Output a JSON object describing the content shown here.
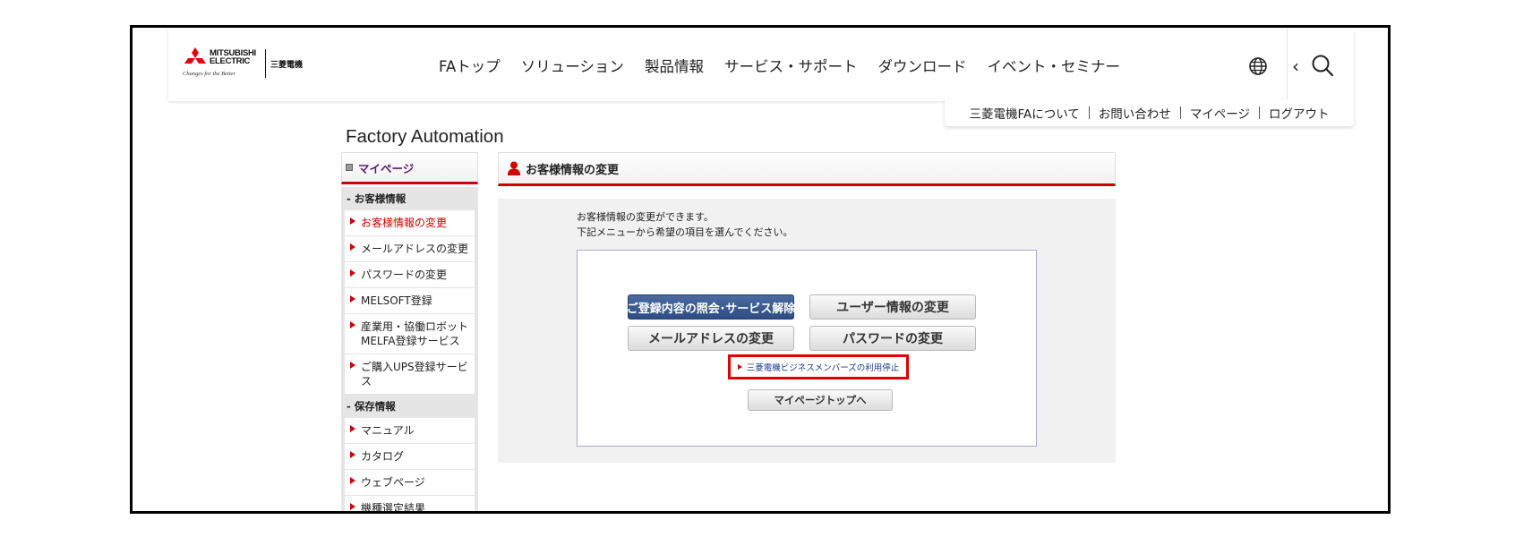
{
  "header": {
    "logo": {
      "brand_line1": "MITSUBISHI",
      "brand_line2": "ELECTRIC",
      "tagline": "Changes for the Better",
      "jp_name": "三菱電機"
    },
    "nav": [
      "FAトップ",
      "ソリューション",
      "製品情報",
      "サービス・サポート",
      "ダウンロード",
      "イベント・セミナー"
    ],
    "icons": {
      "globe": "globe-icon",
      "back": "chevron-left-icon",
      "search": "search-icon"
    }
  },
  "utility_links": [
    "三菱電機FAについて",
    "お問い合わせ",
    "マイページ",
    "ログアウト"
  ],
  "page_title": "Factory Automation",
  "sidebar": {
    "title": "マイページ",
    "sections": [
      {
        "label": "- お客様情報",
        "items": [
          {
            "label": "お客様情報の変更",
            "active": true
          },
          {
            "label": "メールアドレスの変更"
          },
          {
            "label": "パスワードの変更"
          },
          {
            "label": "MELSOFT登録"
          },
          {
            "label": "産業用・協働ロボット MELFA登録サービス",
            "line1": "産業用・協働ロボット",
            "line2": "MELFA登録サービス"
          },
          {
            "label": "ご購入UPS登録サービス"
          }
        ]
      },
      {
        "label": "- 保存情報",
        "items": [
          {
            "label": "マニュアル"
          },
          {
            "label": "カタログ"
          },
          {
            "label": "ウェブページ"
          },
          {
            "label": "機種選定結果"
          }
        ]
      }
    ]
  },
  "main": {
    "heading": "お客様情報の変更",
    "description_line1": "お客様情報の変更ができます。",
    "description_line2": "下記メニューから希望の項目を選んでください。",
    "buttons": {
      "inquiry": "ご登録内容の照会･サービス解除",
      "user_info": "ユーザー情報の変更",
      "email": "メールアドレスの変更",
      "password": "パスワードの変更",
      "mypage_top": "マイページトップへ"
    },
    "stop_link": "三菱電機ビジネスメンバーズの利用停止"
  },
  "colors": {
    "accent_red": "#cc0000",
    "primary_blue": "#2e4d82",
    "highlight_box": "#e00000"
  }
}
